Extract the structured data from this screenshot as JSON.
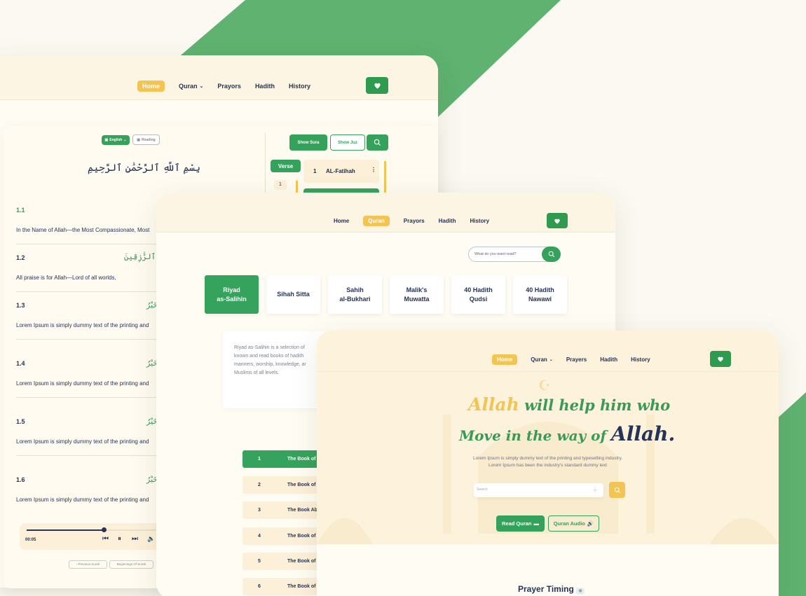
{
  "colors": {
    "brand_green": "#35a25c",
    "accent_yellow": "#f2c454",
    "navy": "#253358",
    "cream": "#fffcf3"
  },
  "screen1": {
    "nav": {
      "home": "Home",
      "quran": "Quran",
      "prayers": "Prayors",
      "hadith": "Hadith",
      "history": "History"
    },
    "lang_select": "English",
    "reading_toggle": "Reading",
    "bismillah": "بِسْمِ ٱللَّهِ ٱلرَّحْمَٰنِ ٱلرَّحِيمِ",
    "show_sura": "Show Sura",
    "show_juz": "Show Juz",
    "verse_tab": "Verse",
    "surah_item": {
      "num": "1",
      "name": "AL-Fatihah"
    },
    "verse_list_num": "1",
    "verses": [
      {
        "num": "1.1",
        "text": "In the Name of Allah—the Most Compassionate, Most",
        "arabic": ""
      },
      {
        "num": "1.2",
        "text": "All praise is for Allah—Lord of all worlds,",
        "arabic": "خَيْرُ ٱلرَّٰزِقِينَ"
      },
      {
        "num": "1.3",
        "text": "Lorem Ipsum is simply dummy text of the printing and",
        "arabic": "خَيْرُ"
      },
      {
        "num": "1.4",
        "text": "Lorem Ipsum is simply dummy text of the printing and",
        "arabic": "خَيْرُ"
      },
      {
        "num": "1.5",
        "text": "Lorem Ipsum is simply dummy text of the printing and",
        "arabic": "خَيْرُ"
      },
      {
        "num": "1.6",
        "text": "Lorem Ipsum is simply dummy text of the printing and",
        "arabic": "خَيْرُ"
      }
    ],
    "audio": {
      "time": "00:05",
      "progress": 0.55
    },
    "prev_surah": "Previous Surah",
    "beginning": "Beginnings Of Surah"
  },
  "screen2": {
    "nav": {
      "home": "Home",
      "quran": "Quran",
      "prayers": "Prayors",
      "hadith": "Hadith",
      "history": "History"
    },
    "search_placeholder": "What do you want read?",
    "books": [
      "Riyad\nas-Salihin",
      "Sihah Sitta",
      "Sahih\nal-Bukhari",
      "Malik's\nMuwatta",
      "40 Hadith\nQudsi",
      "40 Hadith\nNawawi"
    ],
    "desc_lines": [
      "Riyad as-Salihin is a selection of",
      "known and read books of hadith",
      "manners, worship, knowledge, ar",
      "Muslims of all levels."
    ],
    "chapters": [
      {
        "num": "1",
        "title": "The Book of"
      },
      {
        "num": "2",
        "title": "The Book of"
      },
      {
        "num": "3",
        "title": "The Book Ab"
      },
      {
        "num": "4",
        "title": "The Book of"
      },
      {
        "num": "5",
        "title": "The Book of"
      },
      {
        "num": "6",
        "title": "The Book of"
      }
    ]
  },
  "screen3": {
    "nav": {
      "home": "Home",
      "quran": "Quran",
      "prayers": "Prayers",
      "hadith": "Hadith",
      "history": "History"
    },
    "hero_line1_a": "Allah",
    "hero_line1_b": "will help him who",
    "hero_line2_a": "Move in the way of",
    "hero_line2_b": "Allah.",
    "hero_sub1": "Lorem Ipsum is simply dummy text of the printing and typesetting industry.",
    "hero_sub2": "Lorem Ipsum has been the industry's standard dummy text",
    "search_placeholder": "Search",
    "read_quran": "Read Quran",
    "quran_audio": "Quran Audio",
    "prayer_timing": "Prayer Timing"
  }
}
